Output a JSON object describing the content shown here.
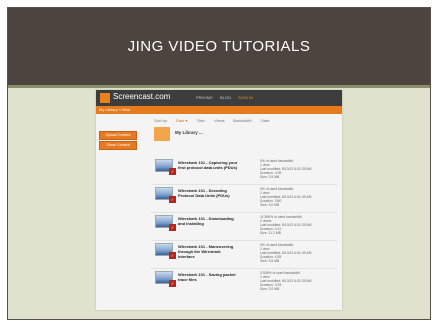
{
  "slide": {
    "title": "JING VIDEO TUTORIALS"
  },
  "screenshot": {
    "logo_text": "Screencast.com",
    "nav": [
      "PRICING",
      "BLOG",
      "SIGN IN"
    ],
    "breadcrumb": "My Library » Wire",
    "sort_label": "Sort by:",
    "sort_options": [
      "Date ▾",
      "Size",
      "Views",
      "Bandwidth",
      "Date"
    ],
    "buttons": [
      "Upload Content",
      "Share Content"
    ],
    "library_title": "My Library ...",
    "videos": [
      {
        "title": "Wireshark 101 - Capturing your first protocol data units (PDUs)",
        "meta": [
          "0% of used bandwidth",
          "1 view",
          "Last modified: 8/13/13 4:51:39 AM",
          "Duration: 4:35",
          "Size: 3.5 MB"
        ]
      },
      {
        "title": "Wireshark 101 - Decoding Protocol Data Units (PDUs)",
        "meta": [
          "0% of used bandwidth",
          "1 view",
          "Last modified: 8/13/13 4:51:39 AM",
          "Duration: 3:50",
          "Size: 3.0 MB"
        ]
      },
      {
        "title": "Wireshark 101 - Downloading and Installing",
        "meta": [
          "11.906% of used bandwidth",
          "2 views",
          "Last modified: 8/13/13 4:51:39 AM",
          "Duration: 4:11",
          "Size: 11.2 MB"
        ]
      },
      {
        "title": "Wireshark 101 - Maneuvering through the Wireshark Interface",
        "meta": [
          "0% of used bandwidth",
          "1 view",
          "Last modified: 8/13/13 4:51:39 AM",
          "Duration: 4:35",
          "Size: 3.5 MB"
        ]
      },
      {
        "title": "Wireshark 101 - Saving packet trace files",
        "meta": [
          "3.906% of used bandwidth",
          "1 view",
          "Last modified: 8/13/13 4:51:39 AM",
          "Duration: 3:33",
          "Size: 3.0 MB"
        ]
      }
    ]
  },
  "colors": {
    "banner": "#4d4440",
    "slide_background": "#dfe3cd",
    "accent_orange": "#e77a1a"
  }
}
